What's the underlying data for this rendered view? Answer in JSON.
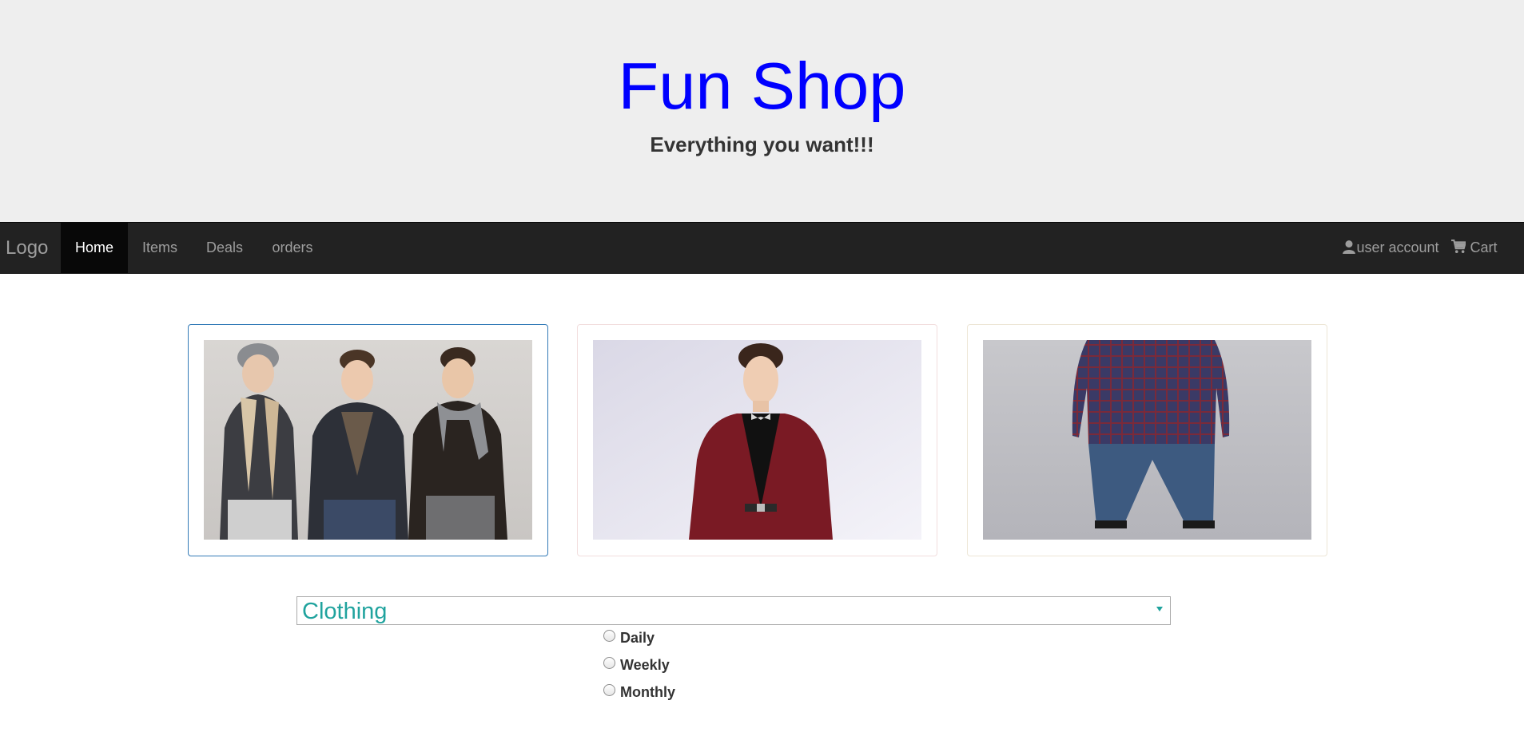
{
  "header": {
    "brand": "Fun Shop",
    "tagline": "Everything you want!!!",
    "brand_color": "#0000ff",
    "background": "#eeeeee"
  },
  "navbar": {
    "logo": "Logo",
    "items": [
      {
        "label": "Home",
        "active": true
      },
      {
        "label": "Items",
        "active": false
      },
      {
        "label": "Deals",
        "active": false
      },
      {
        "label": "orders",
        "active": false
      }
    ],
    "right": [
      {
        "label": "user account",
        "icon": "user-icon"
      },
      {
        "label": "Cart",
        "icon": "cart-icon"
      }
    ],
    "background": "#222222"
  },
  "carousel": {
    "cards": [
      {
        "image": "three men in winter jackets and scarves",
        "border_color": "#337ab7"
      },
      {
        "image": "man in burgundy suit with bow tie",
        "border_color": "#f2dede"
      },
      {
        "image": "man in plaid shirt and jeans seen from behind",
        "border_color": "#ede6d6"
      }
    ]
  },
  "category_select": {
    "value": "Clothing",
    "color": "#20a39e"
  },
  "frequency": {
    "options": [
      "Daily",
      "Weekly",
      "Monthly"
    ],
    "selected": null
  }
}
